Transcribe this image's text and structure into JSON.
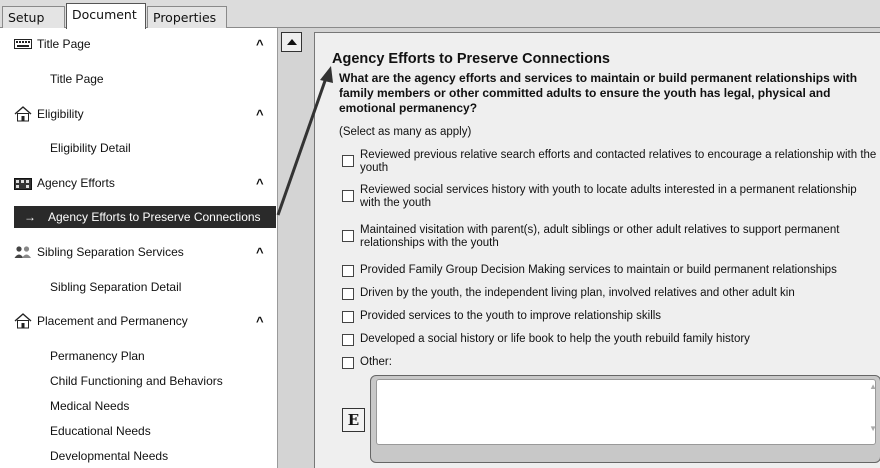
{
  "tabs": [
    {
      "label": "Setup",
      "active": false
    },
    {
      "label": "Document",
      "active": true
    },
    {
      "label": "Properties",
      "active": false
    }
  ],
  "nav": {
    "sections": [
      {
        "label": "Title Page",
        "icon": "keyboard-icon",
        "chevron": "^",
        "items": [
          "Title Page"
        ]
      },
      {
        "label": "Eligibility",
        "icon": "house-icon",
        "chevron": "^",
        "items": [
          "Eligibility Detail"
        ]
      },
      {
        "label": "Agency Efforts",
        "icon": "building-icon",
        "chevron": "^",
        "items": [
          "Agency Efforts to Preserve Connections"
        ]
      },
      {
        "label": "Sibling Separation Services",
        "icon": "people-icon",
        "chevron": "^",
        "items": [
          "Sibling Separation Detail"
        ]
      },
      {
        "label": "Placement and Permanency",
        "icon": "house-icon",
        "chevron": "^",
        "items": [
          "Permanency Plan",
          "Child Functioning and Behaviors",
          "Medical Needs",
          "Educational Needs",
          "Developmental Needs"
        ]
      }
    ],
    "selected_arrow": "→"
  },
  "content": {
    "title": "Agency Efforts to Preserve Connections",
    "question": "What are the agency efforts and services to maintain or build permanent relationships with family members or other committed adults to ensure the youth has legal, physical and emotional permanency?",
    "hint": "(Select as many as apply)",
    "options": [
      "Reviewed previous relative search efforts and contacted relatives to encourage a relationship with the youth",
      "Reviewed social services history with youth to locate adults interested in a permanent relationship with the youth",
      "Maintained visitation with parent(s), adult siblings or other adult relatives to support permanent relationships with the youth",
      "Provided Family Group Decision Making services to maintain or build permanent relationships",
      "Driven by the youth, the independent living plan, involved relatives and other adult kin",
      "Provided services to the youth to improve relationship skills",
      "Developed a social history or life book to help the youth rebuild family history",
      "Other:"
    ],
    "editor_button": "E",
    "other_text": ""
  },
  "colors": {
    "selected_bg": "#2a2a2a",
    "content_bg": "#efefef",
    "nav_bg": "#ffffff"
  }
}
